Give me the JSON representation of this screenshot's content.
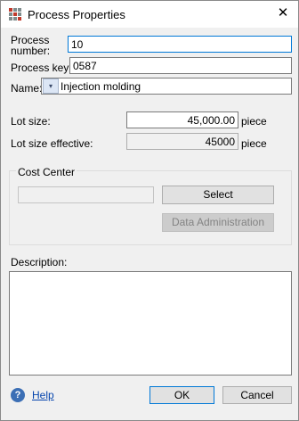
{
  "window": {
    "title": "Process Properties",
    "close_glyph": "✕",
    "icon": "grid-app-icon"
  },
  "fields": {
    "process_number": {
      "label": "Process number:",
      "value": "10"
    },
    "process_key": {
      "label": "Process key:",
      "value": "0587"
    },
    "name": {
      "label": "Name:",
      "value": "Injection molding",
      "dropdown_glyph": "▾"
    },
    "lot_size": {
      "label": "Lot size:",
      "value": "45,000.00",
      "unit": "piece"
    },
    "lot_size_effective": {
      "label": "Lot size effective:",
      "value": "45000",
      "unit": "piece"
    }
  },
  "cost_center": {
    "legend": "Cost Center",
    "value": "",
    "select_label": "Select",
    "data_admin_label": "Data Administration"
  },
  "description": {
    "label": "Description:",
    "value": ""
  },
  "footer": {
    "help_glyph": "?",
    "help_label": "Help",
    "ok_label": "OK",
    "cancel_label": "Cancel"
  },
  "colors": {
    "focus": "#0078d7",
    "link": "#0645ad",
    "help_icon": "#3c6fb5"
  }
}
